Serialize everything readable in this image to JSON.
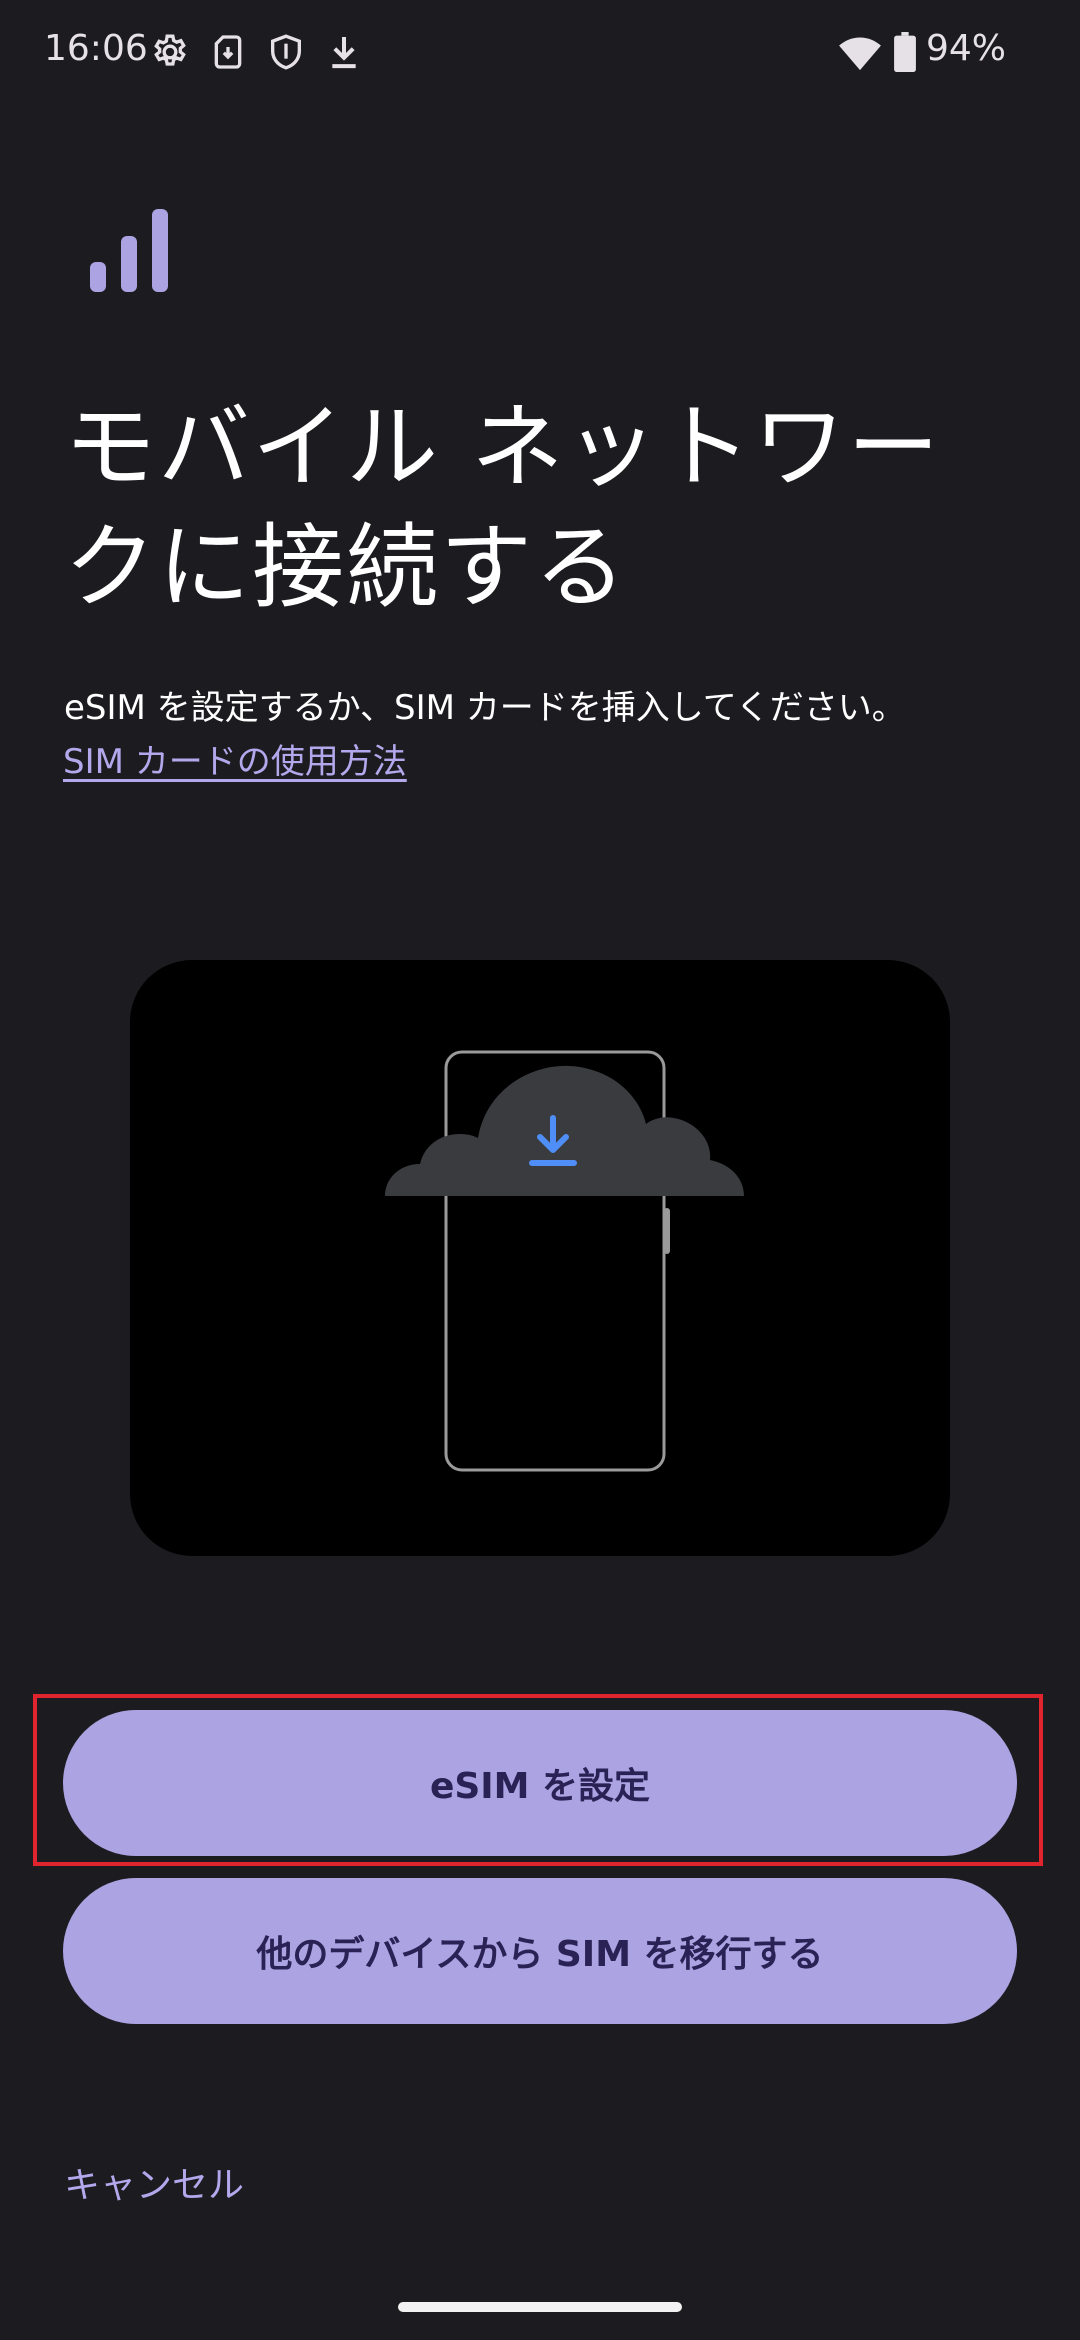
{
  "status_bar": {
    "time": "16:06",
    "battery": "94%",
    "left_icons": [
      "settings-icon",
      "sim-download-icon",
      "shield-icon",
      "download-icon"
    ],
    "right_icons": [
      "wifi-icon",
      "battery-icon"
    ]
  },
  "header": {
    "title": "モバイル ネットワークに接続する",
    "description": "eSIM を設定するか、SIM カードを挿入してください。",
    "help_link": "SIM カードの使用方法"
  },
  "illustration": {
    "icon": "cloud-download-phone-illustration"
  },
  "buttons": {
    "setup_esim": "eSIM を設定",
    "transfer_sim": "他のデバイスから SIM を移行する"
  },
  "footer": {
    "cancel": "キャンセル"
  },
  "colors": {
    "background": "#1c1b20",
    "accent": "#aba3e2",
    "button_text": "#2a2155",
    "link": "#b4a8ec",
    "highlight": "#e0252f",
    "cloud": "#3a3b3f",
    "download_arrow": "#4f8ef7"
  }
}
